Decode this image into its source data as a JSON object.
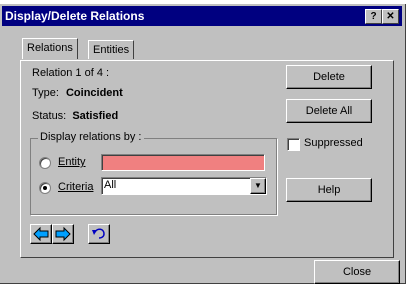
{
  "window": {
    "title": "Display/Delete Relations",
    "help_glyph": "?",
    "close_glyph": "✕"
  },
  "tabs": [
    {
      "label": "Relations"
    },
    {
      "label": "Entities"
    }
  ],
  "relation": {
    "counter": "Relation 1 of 4 :",
    "type_label": "Type:",
    "type_value": "Coincident",
    "status_label": "Status:",
    "status_value": "Satisfied"
  },
  "display_by": {
    "group_label": "Display relations by :",
    "entity_label": "Entity",
    "entity_value": "",
    "criteria_label": "Criteria",
    "criteria_value": "All",
    "selected": "criteria"
  },
  "buttons": {
    "delete": "Delete",
    "delete_all": "Delete All",
    "suppressed": "Suppressed",
    "help": "Help",
    "close": "Close"
  },
  "icons": [
    "arrow-left-icon",
    "arrow-right-icon",
    "undo-icon"
  ],
  "colors": {
    "entity_field": "#f08080",
    "titlebar": "#000080",
    "arrow": "#00a0ff"
  }
}
